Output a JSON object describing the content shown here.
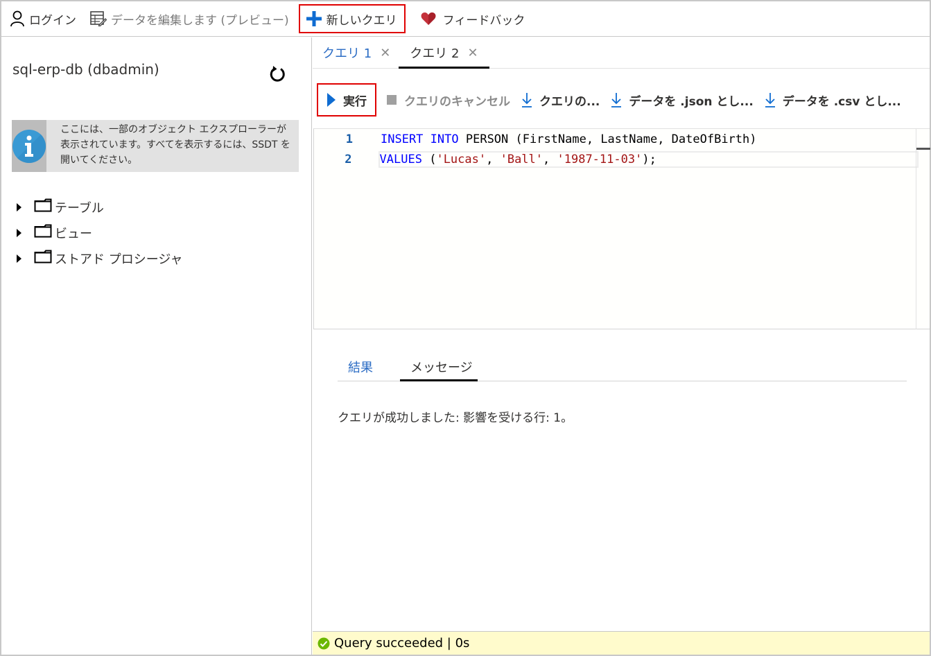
{
  "topbar": {
    "login_label": "ログイン",
    "edit_data_label": "データを編集します (プレビュー)",
    "new_query_label": "新しいクエリ",
    "feedback_label": "フィードバック"
  },
  "left": {
    "server_title": "sql-erp-db (dbadmin)",
    "info_text": "ここには、一部のオブジェクト エクスプローラーが表示されています。すべてを表示するには、SSDT を開いてください。",
    "tree": [
      {
        "label": "テーブル"
      },
      {
        "label": "ビュー"
      },
      {
        "label": "ストアド プロシージャ"
      }
    ]
  },
  "query_tabs": [
    {
      "label": "クエリ 1",
      "active": false
    },
    {
      "label": "クエリ 2",
      "active": true
    }
  ],
  "toolbar": {
    "run_label": "実行",
    "cancel_label": "クエリのキャンセル",
    "save_query_label": "クエリの...",
    "save_json_label": "データを .json とし...",
    "save_csv_label": "データを .csv とし..."
  },
  "editor": {
    "lines": [
      {
        "number": "1",
        "tokens": [
          {
            "t": "INSERT",
            "c": "kw"
          },
          {
            "t": " ",
            "c": ""
          },
          {
            "t": "INTO",
            "c": "kw"
          },
          {
            "t": " PERSON (FirstName, LastName, DateOfBirth)",
            "c": ""
          }
        ]
      },
      {
        "number": "2",
        "tokens": [
          {
            "t": "VALUES",
            "c": "kw"
          },
          {
            "t": " (",
            "c": ""
          },
          {
            "t": "'Lucas'",
            "c": "str"
          },
          {
            "t": ", ",
            "c": ""
          },
          {
            "t": "'Ball'",
            "c": "str"
          },
          {
            "t": ", ",
            "c": ""
          },
          {
            "t": "'1987-11-03'",
            "c": "str"
          },
          {
            "t": ");",
            "c": ""
          }
        ]
      }
    ]
  },
  "results_tabs": [
    {
      "label": "結果",
      "active": false
    },
    {
      "label": "メッセージ",
      "active": true
    }
  ],
  "message": "クエリが成功しました: 影響を受ける行: 1。",
  "status": {
    "text": "Query succeeded | 0s",
    "icon": "check-circle-icon"
  },
  "colors": {
    "accent": "#2b6cc4",
    "highlight_border": "#e00000",
    "status_bg": "#fffbcc",
    "success": "#6bb700"
  }
}
